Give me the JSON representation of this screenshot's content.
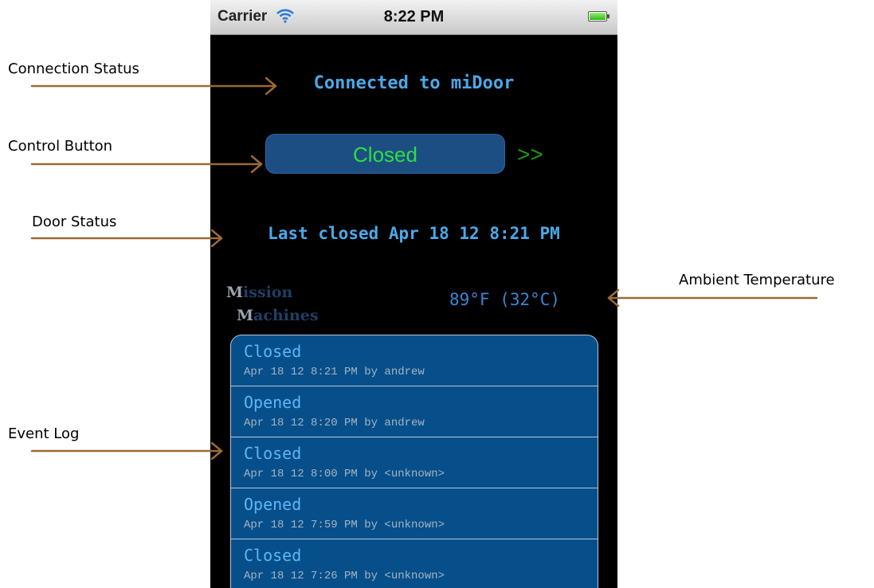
{
  "annotations": {
    "connection_status": "Connection Status",
    "control_button": "Control Button",
    "door_status": "Door Status",
    "ambient_temperature": "Ambient Temperature",
    "event_log": "Event Log",
    "arrow_color": "#9b6a37"
  },
  "status_bar": {
    "carrier": "Carrier",
    "time": "8:22 PM"
  },
  "app": {
    "connection_status": "Connected to miDoor",
    "control_button_label": "Closed",
    "chevrons": ">>",
    "door_status": "Last closed Apr 18 12 8:21 PM",
    "logo": {
      "line1_cap": "M",
      "line1_rest": "ission",
      "line2_cap": "M",
      "line2_rest": "achines"
    },
    "temperature": "89°F (32°C)",
    "events": [
      {
        "title": "Closed",
        "detail": "Apr 18 12 8:21 PM by andrew"
      },
      {
        "title": "Opened",
        "detail": "Apr 18 12 8:20 PM by andrew"
      },
      {
        "title": "Closed",
        "detail": "Apr 18 12 8:00 PM by <unknown>"
      },
      {
        "title": "Opened",
        "detail": "Apr 18 12 7:59 PM by <unknown>"
      },
      {
        "title": "Closed",
        "detail": "Apr 18 12 7:26 PM by <unknown>"
      }
    ]
  },
  "colors": {
    "accent_blue": "#4aa9e9",
    "button_fill": "#1c4e83",
    "button_text": "#2de03d",
    "log_fill": "#064f8a"
  }
}
